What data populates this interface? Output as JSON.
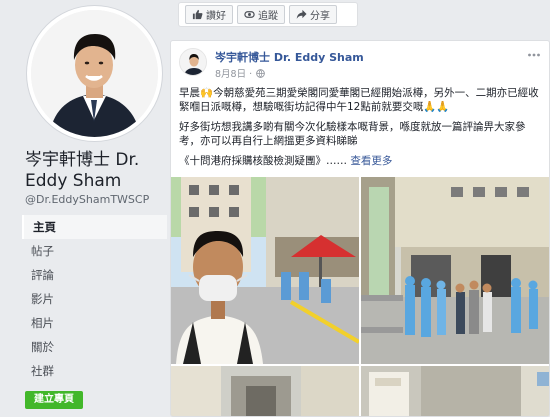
{
  "sidebar": {
    "page_name": "岑宇軒博士 Dr. Eddy Sham",
    "handle": "@Dr.EddyShamTWSCP",
    "nav_items": [
      {
        "label": "主頁"
      },
      {
        "label": "帖子"
      },
      {
        "label": "評論"
      },
      {
        "label": "影片"
      },
      {
        "label": "相片"
      },
      {
        "label": "關於"
      },
      {
        "label": "社群"
      }
    ],
    "create_page_label": "建立專頁"
  },
  "actions": {
    "like_label": "讚好",
    "follow_label": "追蹤",
    "share_label": "分享"
  },
  "post": {
    "author": "岑宇軒博士 Dr. Eddy Sham",
    "date": "8月8日 ·",
    "paragraph1": "早晨🙌今朝慈愛苑三期愛榮閣同愛華閣已經開始派樽，另外一、二期亦已經收緊嗰日派嘅樽，想驗嘅街坊記得中午12點前就要交嘅🙏🙏",
    "paragraph2": "好多街坊想我講多啲有關今次化驗樣本嘅背景，喺度就放一篇評論畀大家參考，亦可以再自行上網搵更多資料睇睇",
    "link_text": "《十問港府採購核酸檢測疑團》……",
    "see_more": "查看更多"
  },
  "colors": {
    "accent": "#365899",
    "button_green": "#42b72a",
    "background": "#e9ebee"
  },
  "icons": [
    "like-icon",
    "follow-icon",
    "share-icon",
    "globe-icon",
    "more-icon"
  ]
}
